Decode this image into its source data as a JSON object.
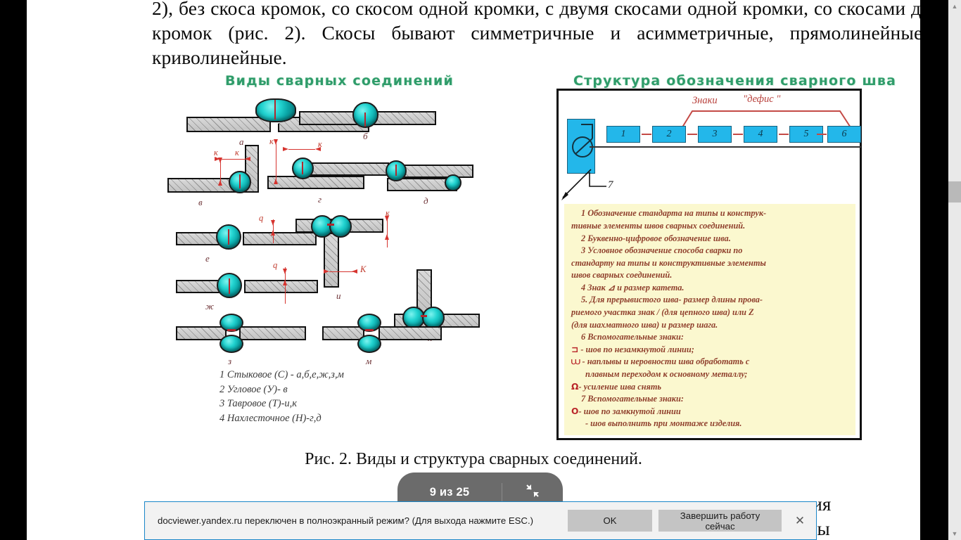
{
  "document": {
    "paragraph": "2), без скоса кромок, со скосом одной кромки, с двумя скосами одной кромки, со скосами двух кромок (рис. 2). Скосы бывают симметричные и асимметричные, прямолинейные и криволинейные.",
    "figure_caption": "Рис. 2. Виды и структура сварных соединений.",
    "tail_text": "ения\nшвы"
  },
  "figure": {
    "left_panel": {
      "title": "Виды  сварных  соединений",
      "joint_marks": [
        "а",
        "б",
        "в",
        "г",
        "д",
        "е",
        "ж",
        "з",
        "и",
        "к",
        "м"
      ],
      "dimension_labels": [
        "к",
        "к",
        "к",
        "к",
        "к",
        "к",
        "q",
        "q",
        "к",
        "К"
      ],
      "legend": [
        "1  Стыковое  (С) - а,б,е,ж,з,м",
        "2  Угловое (У)- в",
        "3  Тавровое (Т)-и,к",
        "4  Нахлесточное  (Н)-г,д"
      ]
    },
    "right_panel": {
      "title": "Структура обозначения  сварного шва",
      "brace_label_1": "Знаки",
      "brace_label_2": "\"дефис \"",
      "boxes": [
        "1",
        "2",
        "3",
        "4",
        "5",
        "6"
      ],
      "arrow_box_label": "7",
      "note_lines": [
        "1  Обозначение  стандарта на типы и конструк-",
        "тивные элементы швов сварных соединений.",
        "2 Буквенно-цифровое обозначение шва.",
        "3  Условное обозначение способа сварки по",
        "стандарту на типы и конструктивные элементы",
        "швов сварных соединений.",
        "4 Знак ⊿ и размер катета.",
        "5.  Для прерывистого шва- размер длины прова-",
        "риемого участка знак  /  (для цепного шва) или Z",
        "(для шахматного шва) и размер шага.",
        "6   Вспомогательные знаки:",
        "- шов по незамкнутой линии;",
        "- наплывы и неровности шва обработать с",
        "плавным переходом к основному металлу;",
        "- усиление шва снять",
        "7     Вспомогательные знаки:",
        "- шов по замкнутой линии",
        "- шов выполнить при монтаже изделия."
      ],
      "note_symbols": [
        "⊐",
        "⩊",
        "Ω",
        "O"
      ]
    }
  },
  "viewer": {
    "page_indicator": "9 из 25",
    "exit_fullscreen_icon": "exit-fullscreen-icon"
  },
  "notification": {
    "message": "docviewer.yandex.ru переключен в полноэкранный режим? (Для выхода нажмите ESC.)",
    "ok_label": "OK",
    "quit_label": "Завершить работу сейчас",
    "close_icon": "close-icon"
  },
  "scrollbar": {
    "up_icon": "chevron-up-icon",
    "down_icon": "chevron-down-icon"
  },
  "colors": {
    "accent_blue": "#23b7ea",
    "bead_teal": "#22d3d0",
    "red": "#c44a46",
    "note_bg": "#fbf8cf",
    "infobar_border": "#1a86c8"
  }
}
